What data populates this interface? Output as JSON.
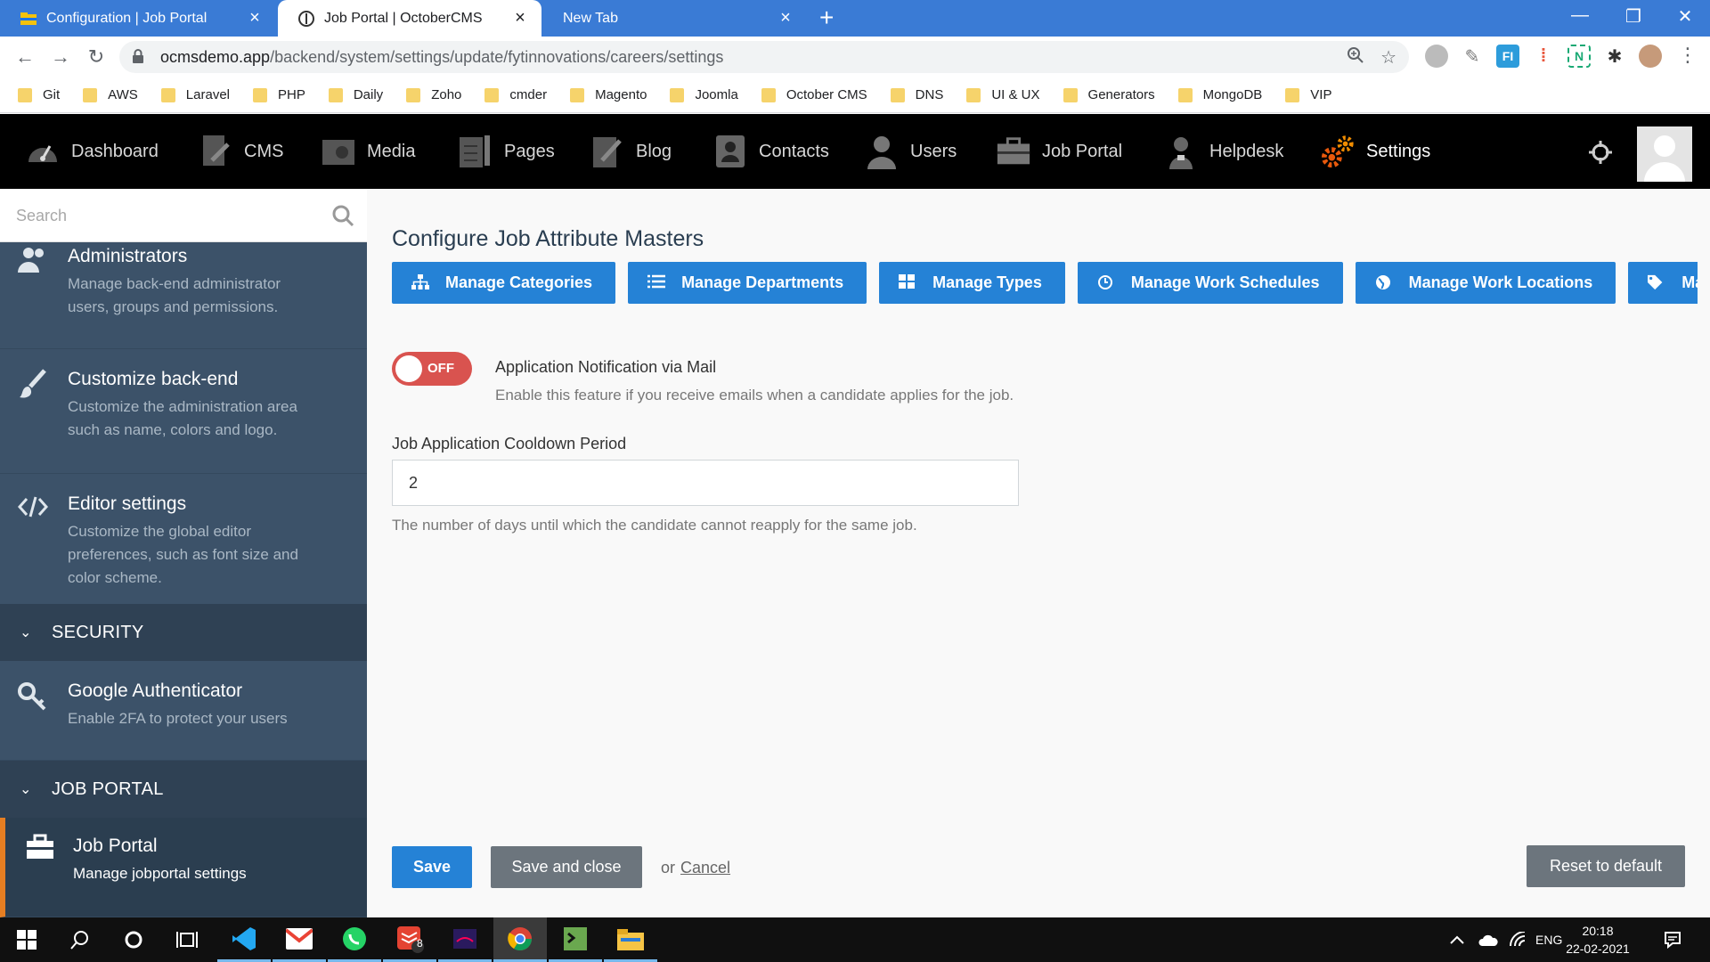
{
  "browser": {
    "tabs": [
      {
        "title": "Configuration | Job Portal"
      },
      {
        "title": "Job Portal | OctoberCMS"
      },
      {
        "title": "New Tab"
      }
    ],
    "url_host": "ocmsdemo.app",
    "url_path": "/backend/system/settings/update/fytinnovations/careers/settings",
    "bookmarks": [
      "Git",
      "AWS",
      "Laravel",
      "PHP",
      "Daily",
      "Zoho",
      "cmder",
      "Magento",
      "Joomla",
      "October CMS",
      "DNS",
      "UI & UX",
      "Generators",
      "MongoDB",
      "VIP"
    ],
    "extensions": [
      "FI",
      "N"
    ]
  },
  "topnav": {
    "items": [
      {
        "label": "Dashboard",
        "icon": "dashboard-icon"
      },
      {
        "label": "CMS",
        "icon": "cms-icon"
      },
      {
        "label": "Media",
        "icon": "media-icon"
      },
      {
        "label": "Pages",
        "icon": "pages-icon"
      },
      {
        "label": "Blog",
        "icon": "blog-icon"
      },
      {
        "label": "Contacts",
        "icon": "contacts-icon"
      },
      {
        "label": "Users",
        "icon": "users-icon"
      },
      {
        "label": "Job Portal",
        "icon": "briefcase-icon"
      },
      {
        "label": "Helpdesk",
        "icon": "helpdesk-icon"
      },
      {
        "label": "Settings",
        "icon": "settings-icon"
      }
    ],
    "active": "Settings"
  },
  "sidebar": {
    "search_placeholder": "Search",
    "items": [
      {
        "title": "Administrators",
        "desc": "Manage back-end administrator users, groups and permissions."
      },
      {
        "title": "Customize back-end",
        "desc": "Customize the administration area such as name, colors and logo."
      },
      {
        "title": "Editor settings",
        "desc": "Customize the global editor preferences, such as font size and color scheme."
      }
    ],
    "security_header": "SECURITY",
    "security_items": [
      {
        "title": "Google Authenticator",
        "desc": "Enable 2FA to protect your users"
      }
    ],
    "jobportal_header": "JOB PORTAL",
    "jobportal_items": [
      {
        "title": "Job Portal",
        "desc": "Manage jobportal settings"
      }
    ]
  },
  "main": {
    "title": "Configure Job Attribute Masters",
    "buttons": [
      {
        "label": "Manage Categories",
        "icon": "sitemap-icon"
      },
      {
        "label": "Manage Departments",
        "icon": "list-icon"
      },
      {
        "label": "Manage Types",
        "icon": "grid-icon"
      },
      {
        "label": "Manage Work Schedules",
        "icon": "clock-icon"
      },
      {
        "label": "Manage Work Locations",
        "icon": "globe-icon"
      },
      {
        "label": "Man",
        "icon": "tags-icon"
      }
    ],
    "notification": {
      "switch_label": "OFF",
      "title": "Application Notification via Mail",
      "help": "Enable this feature if you receive emails when a candidate applies for the job."
    },
    "cooldown": {
      "label": "Job Application Cooldown Period",
      "value": "2",
      "help": "The number of days until which the candidate cannot reapply for the same job."
    },
    "actions": {
      "save": "Save",
      "save_close": "Save and close",
      "or": "or",
      "cancel": "Cancel",
      "reset": "Reset to default"
    }
  },
  "taskbar": {
    "language": "ENG",
    "time": "20:18",
    "date": "22-02-2021",
    "badge_count": "8"
  },
  "colors": {
    "tab_strip": "#3a7bd5",
    "primary_button": "#2582d6",
    "sidebar_bg": "#3c5269",
    "switch_off": "#d9534f",
    "active_accent": "#e67e22"
  }
}
